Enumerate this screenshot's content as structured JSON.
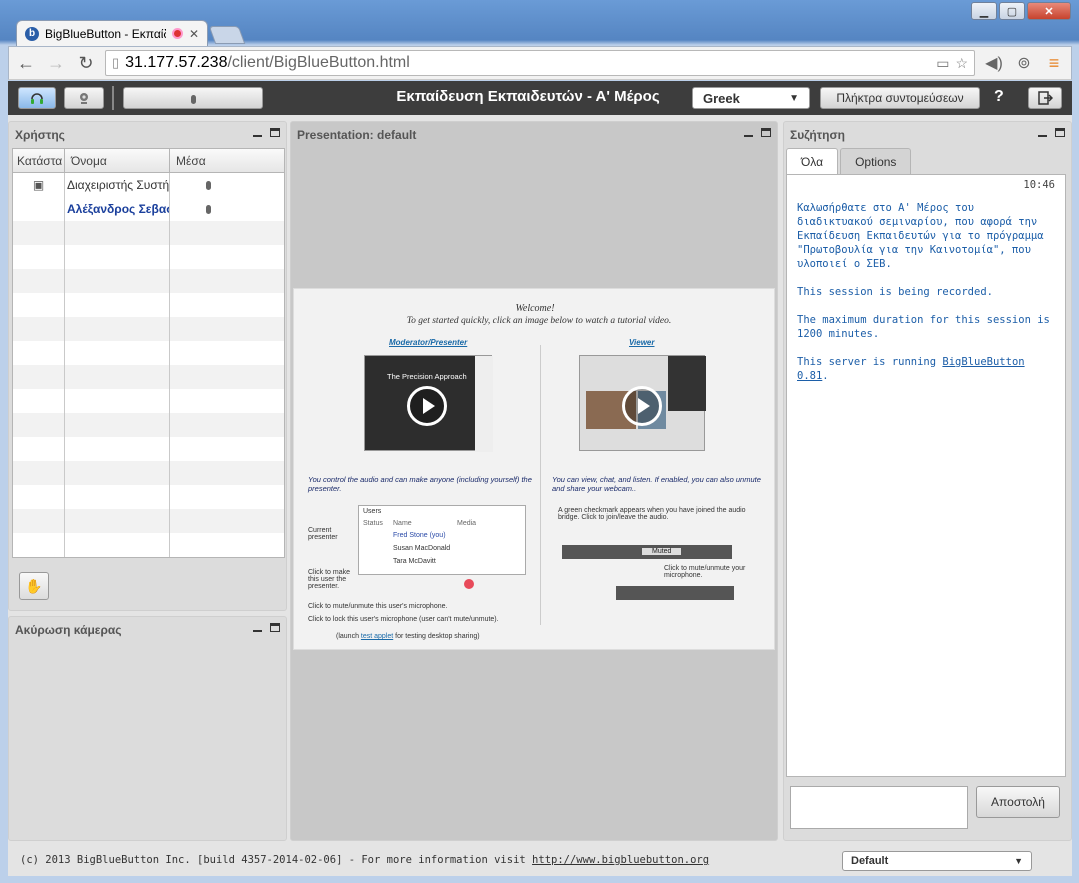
{
  "browser": {
    "tab_title": "BigBlueButton - Εκπαίδ",
    "url_host": "31.177.57.238",
    "url_path": "/client/BigBlueButton.html",
    "menu_glyph": "≡"
  },
  "header": {
    "title": "Εκπαίδευση Εκπαιδευτών - Α' Μέρος",
    "language": "Greek",
    "shortcuts_label": "Πλήκτρα συντομεύσεων",
    "help_label": "?"
  },
  "users": {
    "title": "Χρήστης",
    "columns": [
      "Κατάστα",
      "Όνομα",
      "Μέσα"
    ],
    "rows": [
      {
        "name": "Διαχειριστής Συστήματος"
      },
      {
        "name": "Αλέξανδρος Σεβαστ"
      }
    ]
  },
  "camera": {
    "title": "Ακύρωση κάμερας"
  },
  "presentation": {
    "title": "Presentation: default",
    "slide": {
      "welcome": "Welcome!",
      "subtitle": "To get started quickly, click an image below to watch a tutorial video.",
      "moderator_link": "Moderator/Presenter",
      "viewer_link": "Viewer",
      "thumb_title": "The Precision Approach",
      "moderator_desc": "You control the audio and can make anyone (including yourself) the presenter.",
      "viewer_desc": "You can view, chat, and listen.  If enabled, you can also unmute and share your webcam..",
      "users_label": "Users",
      "mini_cols": [
        "Status",
        "Name",
        "Media"
      ],
      "mini_names": [
        "Fred Stone (you)",
        "Susan MacDonald",
        "Tara McDavitt"
      ],
      "current_presenter": "Current presenter",
      "click_make": "Click to make this user the presenter.",
      "click_mute": "Click to mute/unmute this user's microphone.",
      "click_lock": "Click to lock this user's microphone (user can't mute/unmute).",
      "launch_prefix": "(launch ",
      "launch_link": "test applet",
      "launch_suffix": " for testing desktop sharing)",
      "green_check": "A green checkmark appears when you have joined the audio bridge.  Click to join/leave the audio.",
      "muted": "Muted",
      "mute_mic": "Click to mute/unmute your microphone."
    }
  },
  "chat": {
    "title": "Συζήτηση",
    "tabs": [
      "Όλα",
      "Options"
    ],
    "time": "10:46",
    "messages": [
      "Καλωσήρθατε στο Α' Μέρος του διαδικτυακού σεμιναρίου, που αφορά την Εκπαίδευση Εκπαιδευτών για το πρόγραμμα \"Πρωτοβουλία για την Καινοτομία\", που υλοποιεί ο ΣΕΒ.",
      "This session is being recorded.",
      "The maximum duration for this session is 1200 minutes."
    ],
    "server_prefix": "This server is running ",
    "server_link": "BigBlueButton 0.81",
    "server_suffix": ".",
    "send_label": "Αποστολή"
  },
  "footer": {
    "text": "(c) 2013 BigBlueButton Inc. [build 4357-2014-02-06] - For more information visit ",
    "link": "http://www.bigbluebutton.org",
    "layout": "Default"
  }
}
